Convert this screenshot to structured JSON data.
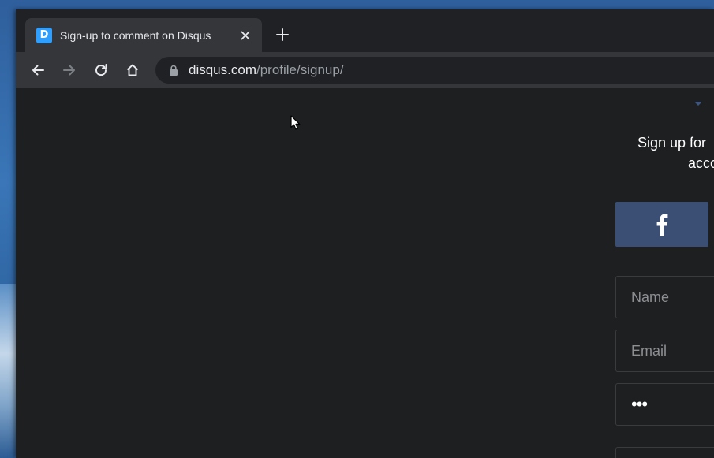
{
  "browser": {
    "tab": {
      "title": "Sign-up to comment on Disqus",
      "favicon_letter": "D",
      "favicon_color": "#2e9fff"
    },
    "address_bar": {
      "host": "disqus.com",
      "path": "/profile/signup/"
    }
  },
  "page": {
    "intro_line1": "Sign up for ",
    "intro_line2": "acco",
    "facebook_icon": "f",
    "fields": {
      "name_placeholder": "Name",
      "email_placeholder": "Email",
      "password_value": "•••"
    }
  },
  "icons": {
    "back": "arrow-left-icon",
    "forward": "arrow-right-icon",
    "reload": "reload-icon",
    "home": "home-icon",
    "lock": "lock-icon",
    "close": "close-icon",
    "new_tab": "plus-icon",
    "facebook": "facebook-icon",
    "cursor": "mouse-cursor-icon"
  },
  "colors": {
    "page_background": "#1e1f21",
    "facebook_button": "#3b4f74",
    "chrome_dark": "#202124",
    "chrome_toolbar": "#35363a"
  }
}
